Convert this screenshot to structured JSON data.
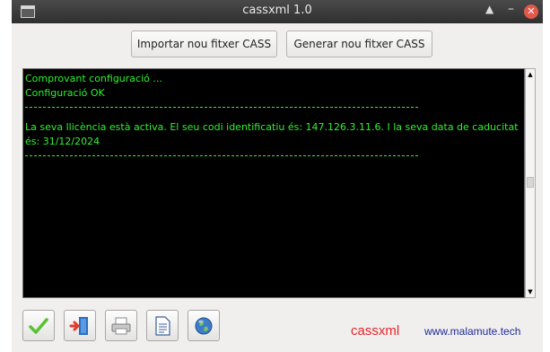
{
  "window": {
    "title": "cassxml 1.0",
    "controls": {
      "eject": "▲",
      "minimize": "–",
      "close": "✕"
    }
  },
  "buttons": {
    "import_label": "Importar nou fitxer CASS",
    "generate_label": "Generar nou fitxer CASS"
  },
  "console": {
    "text_color": "#2ef22e",
    "background": "#000000",
    "lines": [
      "Comprovant configuració ...",
      "Configuració OK",
      "La seva llicència està activa. El seu codi identificatiu és: 147.126.3.11.6.  I la seva data de caducitat",
      "és: 31/12/2024"
    ]
  },
  "toolbar": {
    "icons": [
      "check-icon",
      "exit-door-icon",
      "printer-icon",
      "document-icon",
      "globe-icon"
    ]
  },
  "footer": {
    "brand": "cassxml",
    "brand_color": "#e8252a",
    "website": "www.malamute.tech",
    "website_color": "#202a9a"
  }
}
